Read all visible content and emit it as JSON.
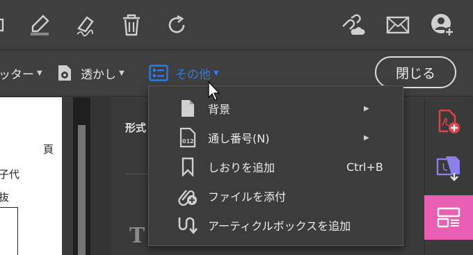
{
  "toolbar": {
    "icons": [
      "expand-icon",
      "highlighter-icon",
      "sign-pen-icon",
      "trash-icon",
      "redo-icon",
      "link-cloud-icon",
      "mail-icon",
      "add-user-icon"
    ]
  },
  "subtoolbar": {
    "footer_label": "ッター",
    "watermark_label": "透かし",
    "other_label": "その他",
    "close_label": "閉じる"
  },
  "document": {
    "lines": [
      "頁",
      "子代",
      "抜"
    ]
  },
  "panel": {
    "format_label": "形式",
    "text_glyph": "T"
  },
  "menu": {
    "items": [
      {
        "label": "背景",
        "icon": "page-icon",
        "submenu": true
      },
      {
        "label": "通し番号(N)",
        "icon": "bates-number-icon",
        "submenu": true
      },
      {
        "label": "しおりを追加",
        "icon": "bookmark-icon",
        "shortcut": "Ctrl+B"
      },
      {
        "label": "ファイルを添付",
        "icon": "attach-icon"
      },
      {
        "label": "アーティクルボックスを追加",
        "icon": "article-icon"
      }
    ]
  },
  "colors": {
    "accent": "#2d7be5",
    "active_tool": "#e85fb4",
    "pdf_red": "#e0434b",
    "combine_purple": "#8b7fe8"
  }
}
